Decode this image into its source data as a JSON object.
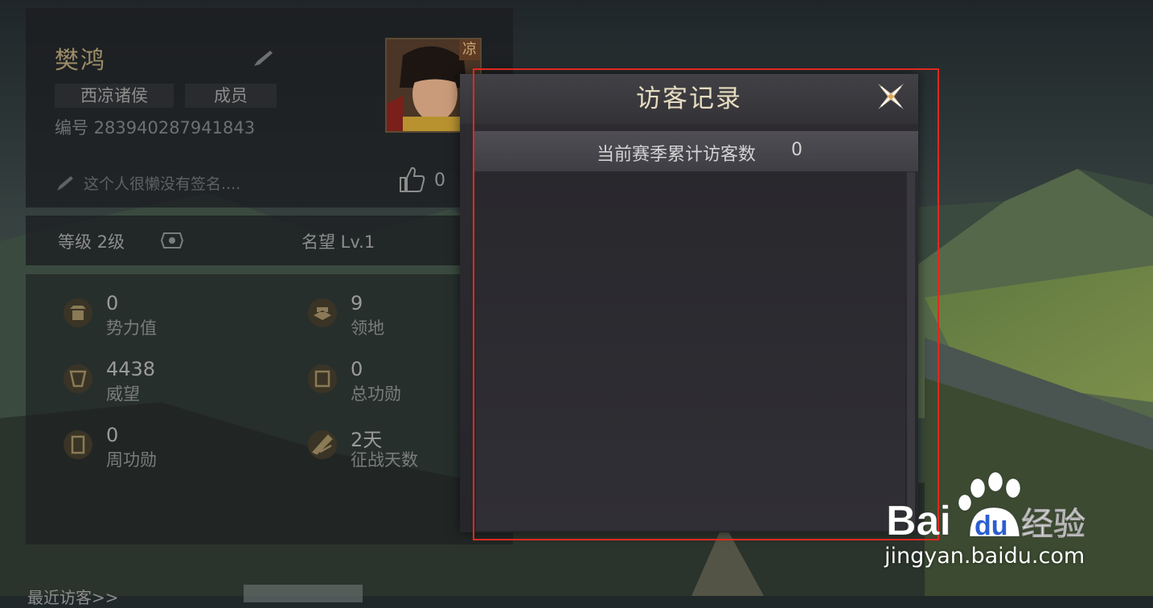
{
  "player": {
    "name": "樊鸿",
    "faction": "西凉诸侯",
    "role": "成员",
    "id_text": "编号 283940287941843",
    "avatar_badge": "凉",
    "signature": "这个人很懒没有签名....",
    "likes": "0",
    "level_text": "等级 2级",
    "fame_text": "名望 Lv.1"
  },
  "stats": [
    {
      "value": "0",
      "label": "势力值",
      "icon": "power-icon"
    },
    {
      "value": "9",
      "label": "领地",
      "icon": "territory-icon"
    },
    {
      "value": "4438",
      "label": "威望",
      "icon": "prestige-icon"
    },
    {
      "value": "0",
      "label": "总功勋",
      "icon": "total-merit-icon"
    },
    {
      "value": "0",
      "label": "周功勋",
      "icon": "weekly-merit-icon"
    },
    {
      "value": "2天",
      "label": "征战天数",
      "icon": "battle-days-icon"
    }
  ],
  "bottom": {
    "recent_visitors": "最近访客>>"
  },
  "dialog": {
    "title": "访客记录",
    "counter_label": "当前赛季累计访客数",
    "counter_value": "0"
  },
  "watermark": {
    "brand": "Bai",
    "brand_suffix": "du",
    "product": "经验",
    "url": "jingyan.baidu.com"
  },
  "colors": {
    "accent_gold": "#9d8d69",
    "highlight_red": "#e0291f",
    "dialog_title": "#e6dcc0"
  }
}
